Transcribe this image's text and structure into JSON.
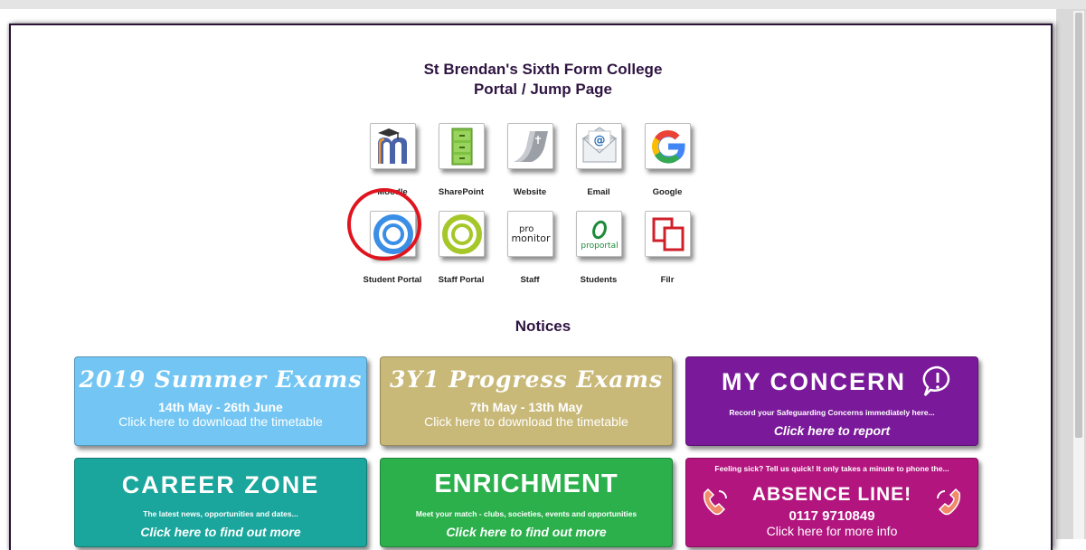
{
  "header": {
    "line1": "St Brendan's Sixth Form College",
    "line2": "Portal / Jump Page"
  },
  "apps_row1": [
    {
      "label": "Moodle",
      "icon": "moodle-icon"
    },
    {
      "label": "SharePoint",
      "icon": "sharepoint-icon"
    },
    {
      "label": "Website",
      "icon": "website-icon"
    },
    {
      "label": "Email",
      "icon": "email-icon"
    },
    {
      "label": "Google",
      "icon": "google-icon"
    }
  ],
  "apps_row2": [
    {
      "label": "Student Portal",
      "icon": "student-portal-icon"
    },
    {
      "label": "Staff Portal",
      "icon": "staff-portal-icon"
    },
    {
      "label": "Staff",
      "icon": "promonitor-icon"
    },
    {
      "label": "Students",
      "icon": "proportal-icon"
    },
    {
      "label": "Filr",
      "icon": "filr-icon"
    }
  ],
  "icon_text": {
    "promonitor_a": "pro",
    "promonitor_b": "monitor",
    "proportal": "proportal",
    "email_at": "@"
  },
  "notices_title": "Notices",
  "banners": {
    "summer": {
      "headline": "2019 Summer Exams",
      "dates": "14th May - 26th June",
      "action": "Click here to download the timetable",
      "color": "#73c6f3"
    },
    "progress": {
      "headline": "3Y1 Progress Exams",
      "dates": "7th May - 13th May",
      "action": "Click here to download the timetable",
      "color": "#c9b979"
    },
    "concern": {
      "headline": "MY CONCERN",
      "subline": "Record your Safeguarding Concerns immediately here...",
      "action": "Click here to report",
      "color": "#7a1a9a"
    },
    "career": {
      "headline": "CAREER ZONE",
      "subline": "The latest news, opportunities and dates...",
      "action": "Click here to find out more",
      "color": "#1aa69c"
    },
    "enrichment": {
      "headline": "ENRICHMENT",
      "subline": "Meet your match - clubs, societies, events and opportunities",
      "action": "Click here to find out more",
      "color": "#2bb04c"
    },
    "absence": {
      "intro": "Feeling sick? Tell us quick! It only takes a minute to phone the...",
      "headline": "ABSENCE LINE!",
      "phone": "0117 9710849",
      "action": "Click here for more info",
      "color": "#b3157f"
    }
  },
  "annotation": {
    "color": "#e0141e"
  }
}
